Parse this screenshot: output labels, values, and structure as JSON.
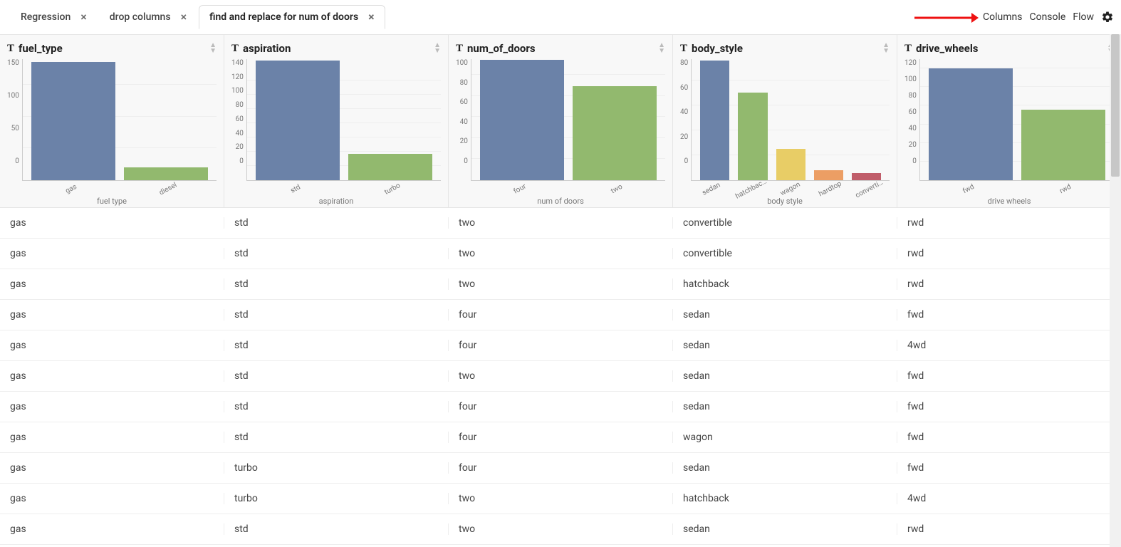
{
  "tabs": [
    {
      "label": "Regression",
      "active": false
    },
    {
      "label": "drop columns",
      "active": false
    },
    {
      "label": "find and replace for num of doors",
      "active": true
    }
  ],
  "topright": {
    "columns": "Columns",
    "console": "Console",
    "flow": "Flow"
  },
  "columns": [
    {
      "name": "fuel_type",
      "axis_title": "fuel type",
      "chart_key": "fuel_type"
    },
    {
      "name": "aspiration",
      "axis_title": "aspiration",
      "chart_key": "aspiration"
    },
    {
      "name": "num_of_doors",
      "axis_title": "num of doors",
      "chart_key": "num_of_doors"
    },
    {
      "name": "body_style",
      "axis_title": "body style",
      "chart_key": "body_style"
    },
    {
      "name": "drive_wheels",
      "axis_title": "drive wheels",
      "chart_key": "drive_wheels"
    }
  ],
  "chart_data": {
    "fuel_type": {
      "type": "bar",
      "categories": [
        "gas",
        "diesel"
      ],
      "values": [
        185,
        20
      ],
      "yticks": [
        0,
        50,
        100,
        150
      ],
      "ylim": [
        0,
        190
      ],
      "xlabel": "fuel type"
    },
    "aspiration": {
      "type": "bar",
      "categories": [
        "std",
        "turbo"
      ],
      "values": [
        168,
        37
      ],
      "yticks": [
        0,
        20,
        40,
        60,
        80,
        100,
        120,
        140
      ],
      "ylim": [
        0,
        170
      ],
      "xlabel": "aspiration"
    },
    "num_of_doors": {
      "type": "bar",
      "categories": [
        "four",
        "two"
      ],
      "values": [
        114,
        89
      ],
      "yticks": [
        0,
        20,
        40,
        60,
        80,
        100
      ],
      "ylim": [
        0,
        115
      ],
      "xlabel": "num of doors"
    },
    "body_style": {
      "type": "bar",
      "categories": [
        "sedan",
        "hatchbac…",
        "wagon",
        "hardtop",
        "converti…"
      ],
      "values": [
        96,
        70,
        25,
        8,
        6
      ],
      "yticks": [
        0,
        20,
        40,
        60,
        80
      ],
      "ylim": [
        0,
        97
      ],
      "xlabel": "body style"
    },
    "drive_wheels": {
      "type": "bar",
      "categories": [
        "fwd",
        "rwd"
      ],
      "values": [
        120,
        76
      ],
      "yticks": [
        0,
        20,
        40,
        60,
        80,
        100,
        120
      ],
      "ylim": [
        0,
        130
      ],
      "xlabel": "drive wheels"
    }
  },
  "rows": [
    {
      "fuel_type": "gas",
      "aspiration": "std",
      "num_of_doors": "two",
      "body_style": "convertible",
      "drive_wheels": "rwd"
    },
    {
      "fuel_type": "gas",
      "aspiration": "std",
      "num_of_doors": "two",
      "body_style": "convertible",
      "drive_wheels": "rwd"
    },
    {
      "fuel_type": "gas",
      "aspiration": "std",
      "num_of_doors": "two",
      "body_style": "hatchback",
      "drive_wheels": "rwd"
    },
    {
      "fuel_type": "gas",
      "aspiration": "std",
      "num_of_doors": "four",
      "body_style": "sedan",
      "drive_wheels": "fwd"
    },
    {
      "fuel_type": "gas",
      "aspiration": "std",
      "num_of_doors": "four",
      "body_style": "sedan",
      "drive_wheels": "4wd"
    },
    {
      "fuel_type": "gas",
      "aspiration": "std",
      "num_of_doors": "two",
      "body_style": "sedan",
      "drive_wheels": "fwd"
    },
    {
      "fuel_type": "gas",
      "aspiration": "std",
      "num_of_doors": "four",
      "body_style": "sedan",
      "drive_wheels": "fwd"
    },
    {
      "fuel_type": "gas",
      "aspiration": "std",
      "num_of_doors": "four",
      "body_style": "wagon",
      "drive_wheels": "fwd"
    },
    {
      "fuel_type": "gas",
      "aspiration": "turbo",
      "num_of_doors": "four",
      "body_style": "sedan",
      "drive_wheels": "fwd"
    },
    {
      "fuel_type": "gas",
      "aspiration": "turbo",
      "num_of_doors": "two",
      "body_style": "hatchback",
      "drive_wheels": "4wd"
    },
    {
      "fuel_type": "gas",
      "aspiration": "std",
      "num_of_doors": "two",
      "body_style": "sedan",
      "drive_wheels": "rwd"
    }
  ]
}
